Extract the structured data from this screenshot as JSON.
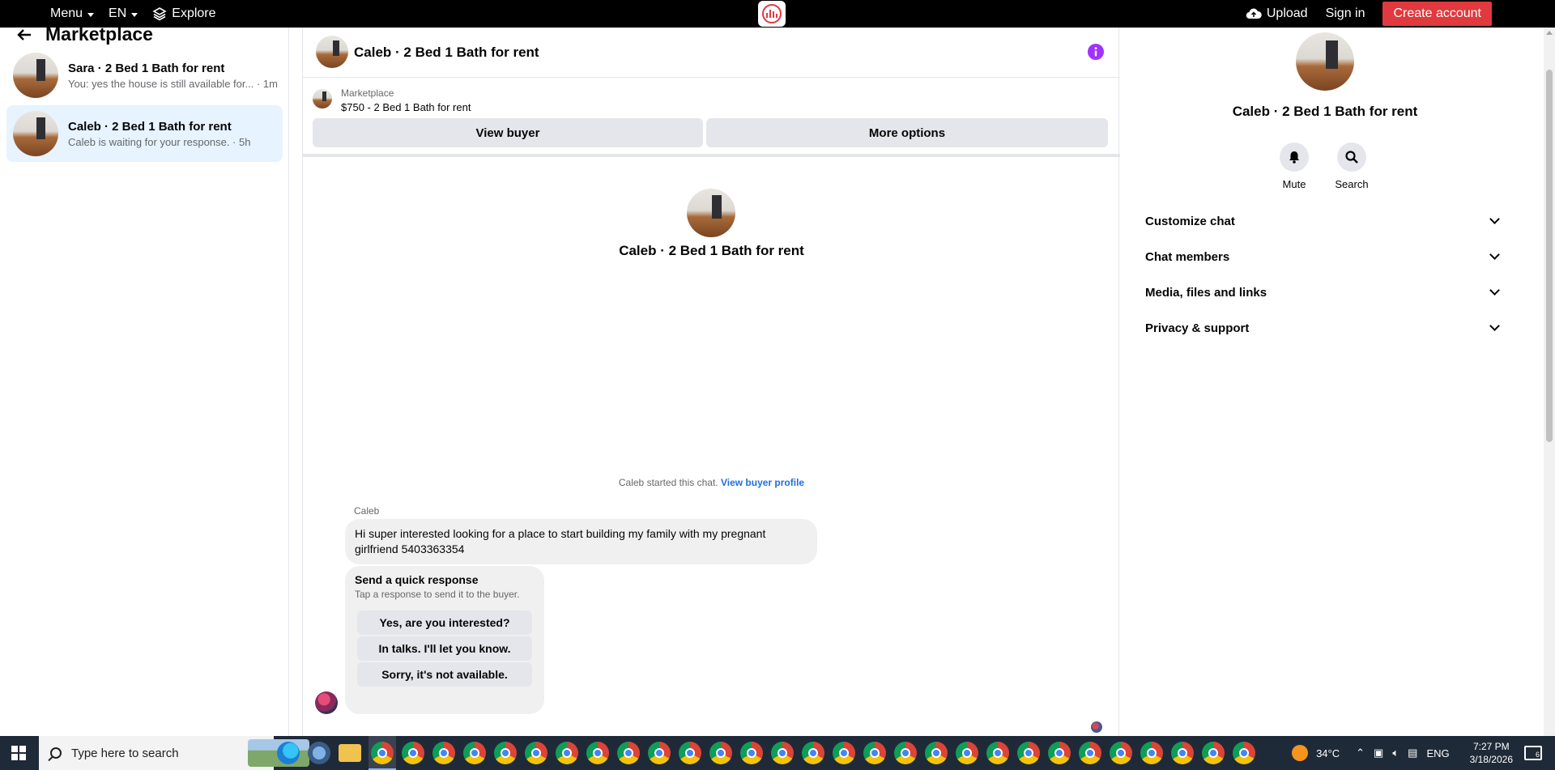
{
  "topbar": {
    "menu_label": "Menu",
    "lang_label": "EN",
    "explore_label": "Explore",
    "upload_label": "Upload",
    "signin_label": "Sign in",
    "create_account_label": "Create account",
    "accent_color": "#e0393e"
  },
  "left": {
    "title": "Marketplace",
    "conversations": [
      {
        "title": "Sara · 2 Bed 1 Bath for rent",
        "preview": "You: yes the house is still available for... · 1m",
        "active": false
      },
      {
        "title": "Caleb · 2 Bed 1 Bath for rent",
        "preview": "Caleb is waiting for your response. · 5h",
        "active": true
      }
    ]
  },
  "chat": {
    "header_title": "Caleb · 2 Bed 1 Bath for rent",
    "listing_source": "Marketplace",
    "listing_price": "$750 - 2 Bed 1 Bath for rent",
    "view_buyer_label": "View buyer",
    "more_options_label": "More options",
    "center_title": "Caleb · 2 Bed 1 Bath for rent",
    "started_text": "Caleb started this chat.",
    "buyer_profile_link": "View buyer profile",
    "sender_name": "Caleb",
    "message_text": "Hi super interested looking for a place to start building my family with my pregnant girlfriend 5403363354",
    "quick_title": "Send a quick response",
    "quick_subtitle": "Tap a response to send it to the buyer.",
    "quick_responses": [
      "Yes, are you interested?",
      "In talks. I'll let you know.",
      "Sorry, it's not available."
    ]
  },
  "details": {
    "title": "Caleb · 2 Bed 1 Bath for rent",
    "mute_label": "Mute",
    "search_label": "Search",
    "sections": [
      "Customize chat",
      "Chat members",
      "Media, files and links",
      "Privacy & support"
    ]
  },
  "taskbar": {
    "search_placeholder": "Type here to search",
    "temperature": "34°C",
    "language": "ENG",
    "time": "7:27 PM",
    "date": "3/18/2026",
    "notification_count": "6"
  }
}
